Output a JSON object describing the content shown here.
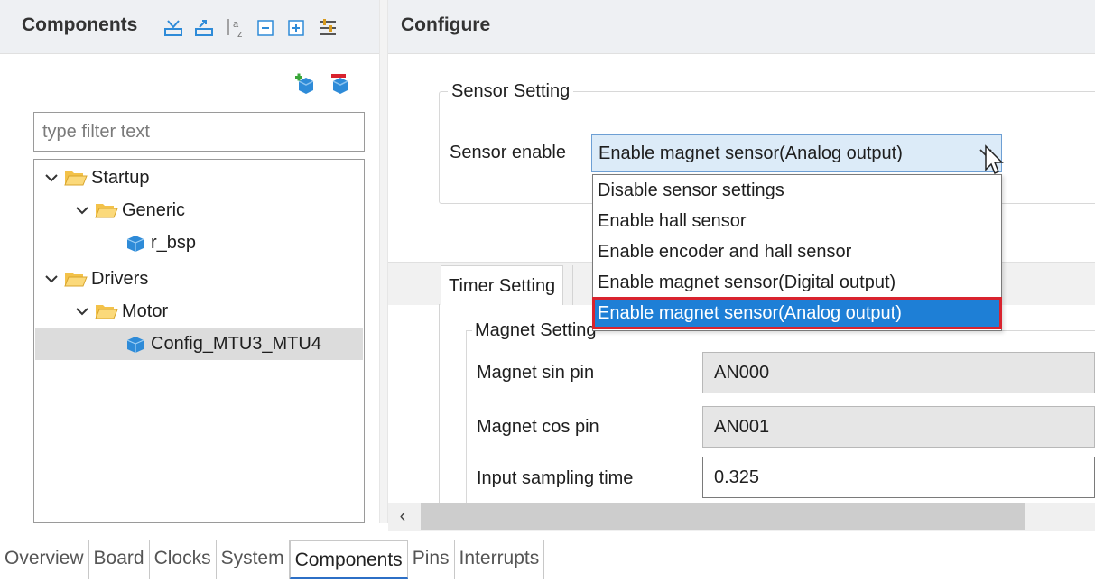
{
  "components_panel": {
    "title": "Components",
    "header_icons": [
      "collapse-down-icon",
      "expand-up-icon",
      "sort-az-icon",
      "collapse-all-icon",
      "expand-all-icon",
      "filter-icon"
    ],
    "filter_placeholder": "type filter text",
    "tree": [
      {
        "label": "Startup",
        "level": 0,
        "kind": "folder",
        "expanded": true
      },
      {
        "label": "Generic",
        "level": 1,
        "kind": "folder",
        "expanded": true
      },
      {
        "label": "r_bsp",
        "level": 2,
        "kind": "component"
      },
      {
        "label": "Drivers",
        "level": 0,
        "kind": "folder",
        "expanded": true
      },
      {
        "label": "Motor",
        "level": 1,
        "kind": "folder",
        "expanded": true
      },
      {
        "label": "Config_MTU3_MTU4",
        "level": 2,
        "kind": "component",
        "selected": true
      }
    ]
  },
  "configure_panel": {
    "title": "Configure",
    "sensor_group": {
      "title": "Sensor Setting",
      "sensor_enable_label": "Sensor enable",
      "selected_value": "Enable magnet sensor(Analog output)",
      "options": [
        "Disable sensor settings",
        "Enable hall sensor",
        "Enable encoder and hall sensor",
        "Enable magnet sensor(Digital output)",
        "Enable magnet sensor(Analog output)"
      ]
    },
    "tabs": {
      "timer_label": "Timer Setting"
    },
    "magnet_group": {
      "title": "Magnet Setting",
      "sin_label": "Magnet sin pin",
      "sin_value": "AN000",
      "cos_label": "Magnet cos pin",
      "cos_value": "AN001",
      "sampling_label": "Input sampling time",
      "sampling_value": "0.325"
    },
    "scroll_left_glyph": "‹"
  },
  "bottom_tabs": [
    "Overview",
    "Board",
    "Clocks",
    "System",
    "Components",
    "Pins",
    "Interrupts"
  ],
  "active_bottom_tab": "Components",
  "colors": {
    "accent_blue": "#1e7fd6",
    "selection_outline": "#d9232e",
    "folder_yellow": "#f3c24a",
    "component_blue": "#2e8bd8"
  }
}
